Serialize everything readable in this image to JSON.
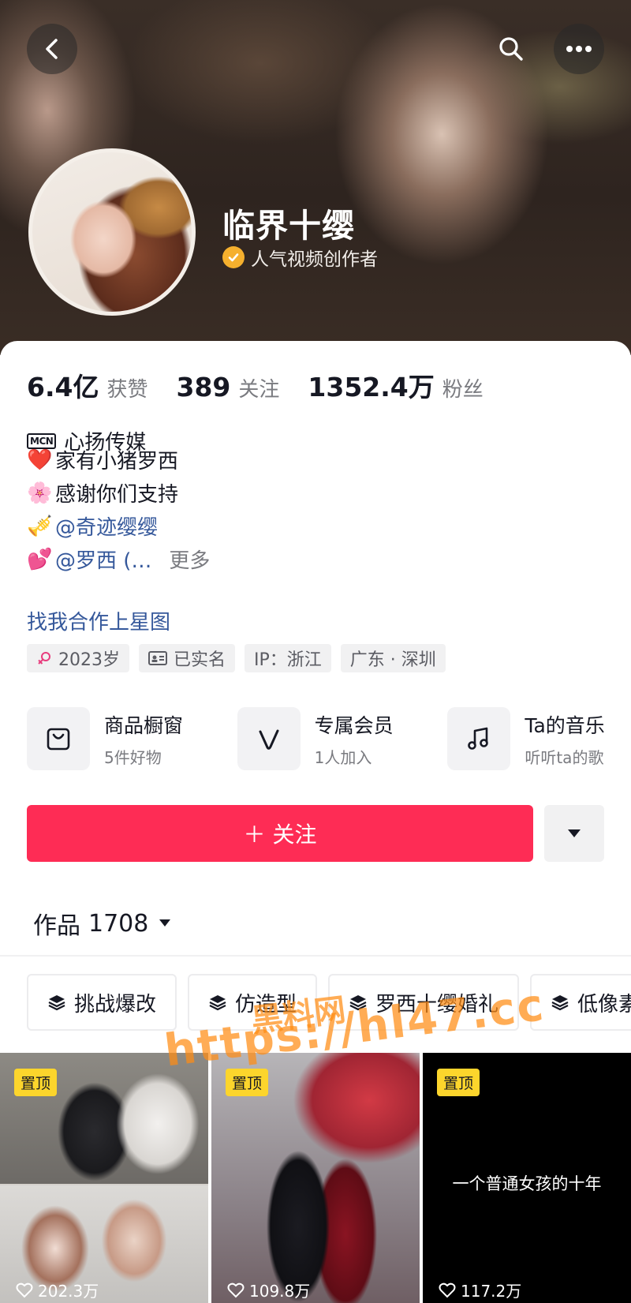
{
  "header": {
    "profile_name": "临界十缨",
    "verify_label": "人气视频创作者"
  },
  "stats": [
    {
      "value": "6.4亿",
      "label": "获赞"
    },
    {
      "value": "389",
      "label": "关注"
    },
    {
      "value": "1352.4万",
      "label": "粉丝"
    }
  ],
  "mcn": {
    "icon_text": "MCN",
    "name": "心扬传媒"
  },
  "bio": {
    "line1": {
      "emoji": "❤️",
      "text": "家有小猪罗西"
    },
    "line2": {
      "emoji": "🌸",
      "text": "感谢你们支持"
    },
    "line3": {
      "emoji": "🎺",
      "text": "@奇迹缨缨"
    },
    "line4": {
      "emoji": "💕",
      "text": "@罗西 (…",
      "more": "更多"
    }
  },
  "star_link": "找我合作上星图",
  "tags": [
    {
      "icon": "female-icon",
      "text": "2023岁"
    },
    {
      "icon": "id-card-icon",
      "text": "已实名"
    },
    {
      "text": "IP：浙江"
    },
    {
      "text": "广东 · 深圳"
    }
  ],
  "features": [
    {
      "icon": "shopping-bag-icon",
      "title": "商品橱窗",
      "sub": "5件好物"
    },
    {
      "icon": "vip-v-icon",
      "title": "专属会员",
      "sub": "1人加入"
    },
    {
      "icon": "music-note-icon",
      "title": "Ta的音乐",
      "sub": "听听ta的歌"
    }
  ],
  "follow_button": "＋ 关注",
  "works": {
    "label": "作品",
    "count": "1708"
  },
  "collections": [
    "挑战爆改",
    "仿造型",
    "罗西十缨婚礼",
    "低像素"
  ],
  "videos": [
    {
      "pinned": "置顶",
      "likes": "202.3万"
    },
    {
      "pinned": "置顶",
      "likes": "109.8万"
    },
    {
      "pinned": "置顶",
      "text": "一个普通女孩的十年",
      "likes": "117.2万"
    }
  ],
  "watermark": {
    "title": "黑料网",
    "url": "https://hl47.cc"
  },
  "colors": {
    "accent": "#fe2c55",
    "link": "#35589b",
    "pin": "#fcd52c",
    "verify": "#f5b02e"
  }
}
